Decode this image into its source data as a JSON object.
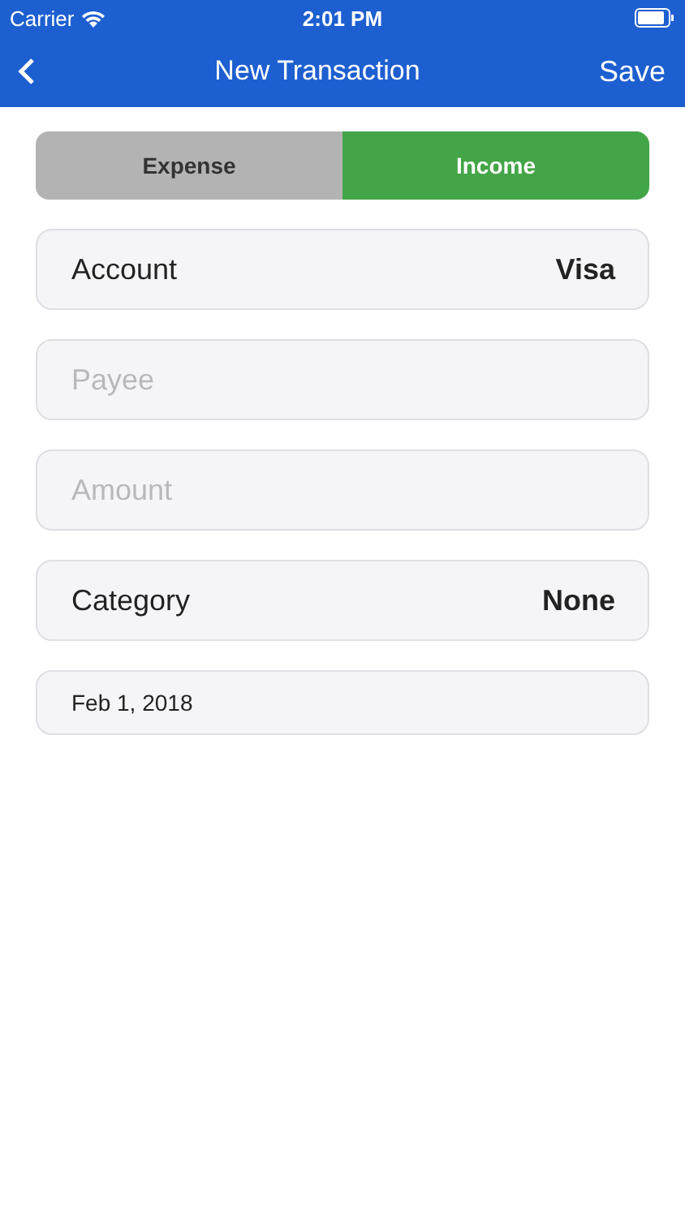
{
  "status_bar": {
    "carrier": "Carrier",
    "time": "2:01 PM"
  },
  "nav": {
    "title": "New Transaction",
    "action": "Save"
  },
  "segments": [
    {
      "label": "Expense",
      "selected": false
    },
    {
      "label": "Income",
      "selected": true
    }
  ],
  "fields": [
    {
      "kind": "picker",
      "label": "Account",
      "value": "Visa"
    },
    {
      "kind": "input",
      "placeholder": "Payee"
    },
    {
      "kind": "input",
      "placeholder": "Amount"
    },
    {
      "kind": "picker",
      "label": "Category",
      "value": "None"
    },
    {
      "kind": "date",
      "value": "Feb 1, 2018"
    }
  ]
}
